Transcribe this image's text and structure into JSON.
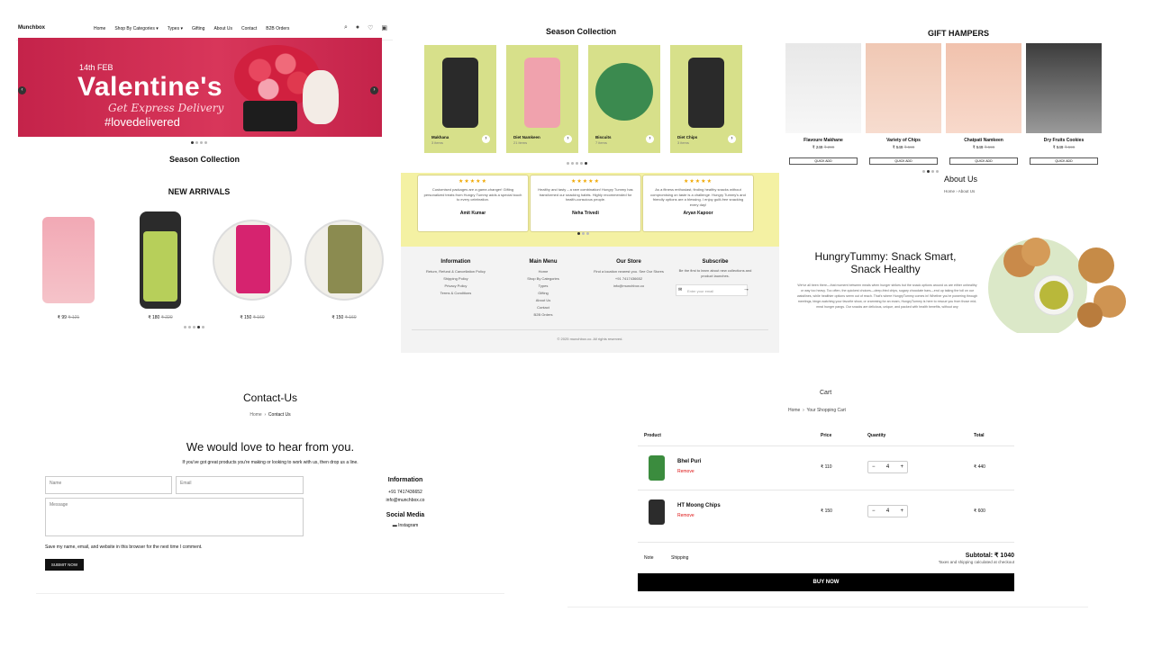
{
  "home": {
    "logo": "Munchbox",
    "menu": [
      "Home",
      "Shop By Categories",
      "Types",
      "Gifting",
      "About Us",
      "Contact",
      "B2B Orders"
    ],
    "banner": {
      "date": "14th FEB",
      "headline": "Valentine's",
      "sub": "Get Express Delivery",
      "tag": "#lovedelivered"
    },
    "season_title": "Season Collection",
    "arrivals_title": "NEW ARRIVALS",
    "arrivals": [
      {
        "price": "₹ 99",
        "old": "₹ 121"
      },
      {
        "price": "₹ 180",
        "old": "₹ 220"
      },
      {
        "price": "₹ 150",
        "old": "₹ 169"
      },
      {
        "price": "₹ 150",
        "old": "₹ 169"
      }
    ]
  },
  "season": {
    "title": "Season Collection",
    "cards": [
      {
        "name": "Makhana",
        "items": "3 items"
      },
      {
        "name": "Diet Namkeen",
        "items": "21 items"
      },
      {
        "name": "Biscuits",
        "items": "7 items"
      },
      {
        "name": "Diet Chips",
        "items": "3 items"
      }
    ],
    "reviews": [
      {
        "stars": "★★★★★",
        "text": "Customised packages are a game-changer! Gifting personalized treats from Hungry Tummy adds a special touch to every celebration.",
        "who": "Amit Kumar"
      },
      {
        "stars": "★★★★★",
        "text": "Healthy and tasty – a rare combination! Hungry Tummy has transformed our snacking habits. Highly recommended for health-conscious people.",
        "who": "Neha Trivedi"
      },
      {
        "stars": "★★★★★",
        "text": "As a fitness enthusiast, finding healthy snacks without compromising on taste is a challenge. Hungry Tummy's and friendly options are a blessing. I enjoy guilt-free snacking every day!",
        "who": "Aryan Kapoor"
      }
    ],
    "footer": {
      "info_title": "Information",
      "info_links": [
        "Return, Refund & Cancellation Policy",
        "Shipping Policy",
        "Privacy Policy",
        "Terms & Conditions"
      ],
      "menu_title": "Main Menu",
      "menu_links": [
        "Home",
        "Shop By Categories",
        "Types",
        "Gifting",
        "About Us",
        "Contact",
        "B2B Orders"
      ],
      "store_title": "Our Store",
      "store_lines": [
        "Find a location nearest you. See Our Stores",
        "+91 7417436652",
        "info@munchbox.co"
      ],
      "sub_title": "Subscribe",
      "sub_text": "Be the first to learn about new collections and product launches.",
      "email_placeholder": "Enter your email",
      "copyright": "© 2025 munchbox.co. All rights reserved."
    }
  },
  "hampers": {
    "title": "GIFT HAMPERS",
    "items": [
      {
        "name": "Flavoure Makhane",
        "price": "₹ 249",
        "old": "₹ 299"
      },
      {
        "name": "Variety of Chips",
        "price": "₹ 549",
        "old": "₹ 599"
      },
      {
        "name": "Chatpati Namkeen",
        "price": "₹ 549",
        "old": "₹ 599"
      },
      {
        "name": "Dry Fruits Cookies",
        "price": "₹ 549",
        "old": "₹ 599"
      }
    ],
    "quick_add": "QUICK ADD",
    "about_title": "About Us",
    "about_bc_home": "Home",
    "about_bc_current": "About Us",
    "about_head": "HungryTummy: Snack Smart, Snack Healthy",
    "about_body": "We've all been there—that moment between meals when hunger strikes but the snack options around us are either unhealthy or way too heavy. Too often, the quickest choices—deep-fried chips, sugary chocolate bars—end up taking the toll on our waistlines, while healthier options seem out of reach. That's where HungryTummy comes in! Whether you're powering through meetings, binge-watching your favorite show, or cramming for an exam, HungryTummy is here to rescue you from those mid-meal hunger pangs. Our snacks are delicious, unique, and packed with health benefits, without any"
  },
  "contact": {
    "title": "Contact-Us",
    "bc_home": "Home",
    "bc_current": "Contact Us",
    "head": "We would love to hear from you.",
    "sub": "If you've got great products you're making or looking to work with us, then drop us a line.",
    "name_ph": "Name",
    "email_ph": "Email",
    "message_ph": "Message",
    "info_title": "Information",
    "phone": "+91 7417436652",
    "email": "info@munchbox.co",
    "social_title": "Social Media",
    "social_link": "Instagram",
    "save_label": "Save my name, email, and website in this browser for the next time I comment.",
    "submit": "SUBMIT NOW"
  },
  "cart": {
    "title": "Cart",
    "bc_home": "Home",
    "bc_current": "Your Shopping Cart",
    "headers": {
      "product": "Product",
      "price": "Price",
      "quantity": "Quantity",
      "total": "Total"
    },
    "rows": [
      {
        "name": "Bhel Puri",
        "remove": "Remove",
        "price": "₹ 110",
        "qty": "4",
        "total": "₹ 440"
      },
      {
        "name": "HT Moong Chips",
        "remove": "Remove",
        "price": "₹ 150",
        "qty": "4",
        "total": "₹ 600"
      }
    ],
    "note": "Note",
    "shipping": "Shipping",
    "subtotal": "Subtotal: ₹ 1040",
    "taxes": "Taxes and shipping calculated at checkout",
    "buy": "BUY NOW"
  },
  "colors": {
    "banner": "#c4234a",
    "season_card": "#d7e08a",
    "review_band": "#f4f1a3",
    "accent_red": "#d11111"
  }
}
